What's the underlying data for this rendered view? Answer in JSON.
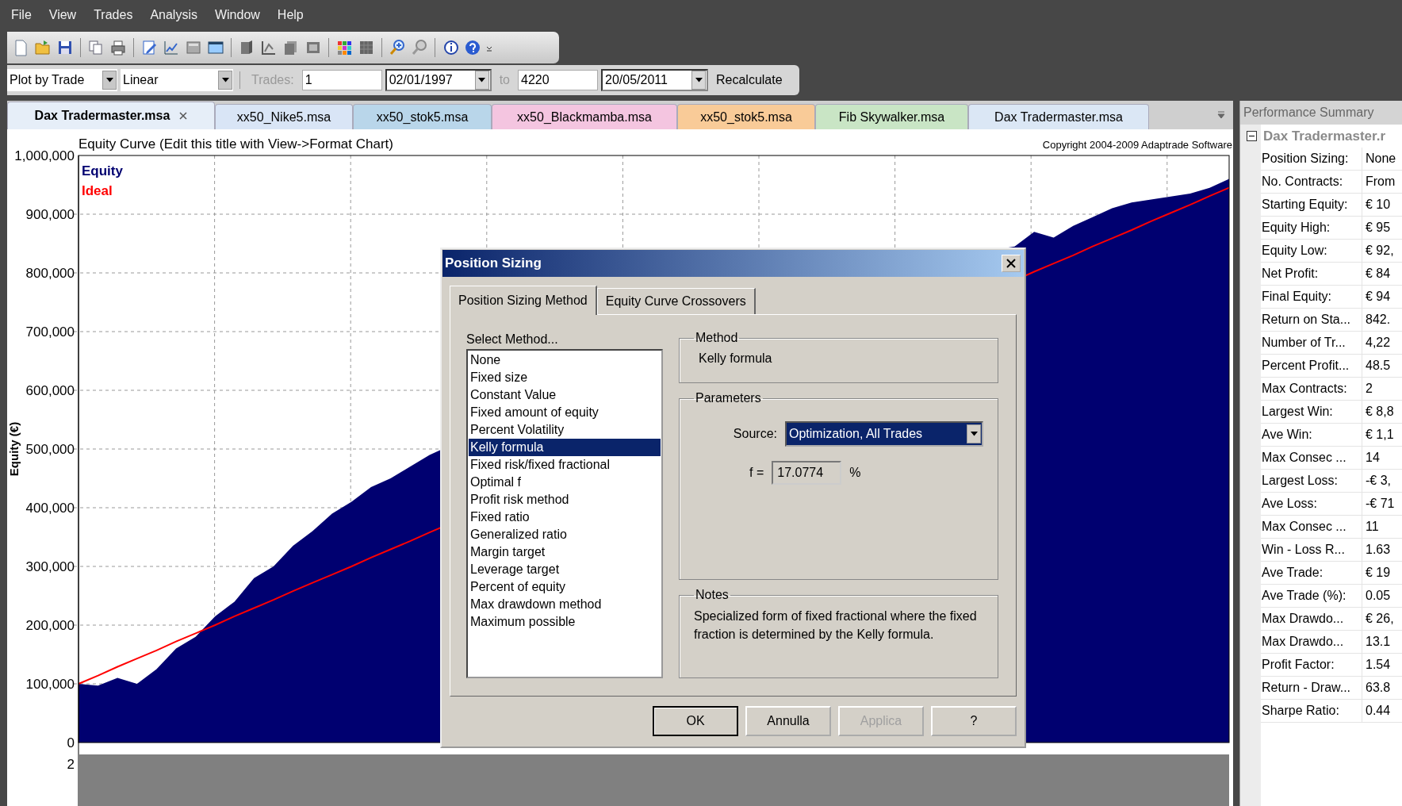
{
  "menu": [
    "File",
    "View",
    "Trades",
    "Analysis",
    "Window",
    "Help"
  ],
  "options_bar": {
    "plot_mode": "Plot by Trade",
    "scale": "Linear",
    "trades_label": "Trades:",
    "trades_from": "1",
    "date_from": "02/01/1997",
    "to_label": "to",
    "trades_to": "4220",
    "date_to": "20/05/2011",
    "recalculate": "Recalculate"
  },
  "document_tabs": [
    {
      "label": "Dax Tradermaster.msa",
      "selected": true,
      "closable": true,
      "color": "#e6eef8"
    },
    {
      "label": "xx50_Nike5.msa",
      "selected": false,
      "closable": false,
      "color": "#d9e5f6"
    },
    {
      "label": "xx50_stok5.msa",
      "selected": false,
      "closable": false,
      "color": "#b9d6ea"
    },
    {
      "label": "xx50_Blackmamba.msa",
      "selected": false,
      "closable": false,
      "color": "#f4c5e0"
    },
    {
      "label": "xx50_stok5.msa",
      "selected": false,
      "closable": false,
      "color": "#f9cb98"
    },
    {
      "label": "Fib Skywalker.msa",
      "selected": false,
      "closable": false,
      "color": "#c9e5c5"
    },
    {
      "label": "Dax Tradermaster.msa",
      "selected": false,
      "closable": false,
      "color": "#dbe7f5"
    }
  ],
  "chart": {
    "title": "Equity Curve (Edit this title with View->Format Chart)",
    "copyright": "Copyright 2004-2009 Adaptrade Software",
    "y_axis_label": "Equity (€)",
    "lower_pane_tick": "2",
    "legend": [
      {
        "name": "Equity",
        "color": "#000070"
      },
      {
        "name": "Ideal",
        "color": "#ff0000"
      }
    ],
    "y_ticks": [
      "1,000,000",
      "900,000",
      "800,000",
      "700,000",
      "600,000",
      "500,000",
      "400,000",
      "300,000",
      "200,000",
      "100,000",
      "0"
    ]
  },
  "performance": {
    "title": "Performance Summary",
    "root": {
      "label": "Dax Tradermaster.r",
      "expanded": true
    },
    "rows": [
      {
        "label": "Position Sizing:",
        "value": "None"
      },
      {
        "label": "No. Contracts:",
        "value": "From"
      },
      {
        "label": "Starting Equity:",
        "value": "€ 10"
      },
      {
        "label": "Equity High:",
        "value": "€ 95"
      },
      {
        "label": "Equity Low:",
        "value": "€ 92,"
      },
      {
        "label": "Net Profit:",
        "value": "€ 84"
      },
      {
        "label": "Final Equity:",
        "value": "€ 94"
      },
      {
        "label": "Return on Sta...",
        "value": "842."
      },
      {
        "label": "Number of Tr...",
        "value": "4,22"
      },
      {
        "label": "Percent Profit...",
        "value": "48.5"
      },
      {
        "label": "Max Contracts:",
        "value": "2"
      },
      {
        "label": "Largest Win:",
        "value": "€ 8,8"
      },
      {
        "label": "Ave Win:",
        "value": "€ 1,1"
      },
      {
        "label": "Max Consec ...",
        "value": "14"
      },
      {
        "label": "Largest Loss:",
        "value": "-€ 3,"
      },
      {
        "label": "Ave Loss:",
        "value": "-€ 71"
      },
      {
        "label": "Max Consec ...",
        "value": "11"
      },
      {
        "label": "Win - Loss R...",
        "value": "1.63"
      },
      {
        "label": "Ave Trade:",
        "value": "€ 19"
      },
      {
        "label": "Ave Trade (%):",
        "value": "0.05"
      },
      {
        "label": "Max Drawdo...",
        "value": "€ 26,"
      },
      {
        "label": "Max Drawdo...",
        "value": "13.1"
      },
      {
        "label": "Profit Factor:",
        "value": "1.54"
      },
      {
        "label": "Return - Draw...",
        "value": "63.8"
      },
      {
        "label": "Sharpe Ratio:",
        "value": "0.44"
      }
    ]
  },
  "dialog": {
    "title": "Position Sizing",
    "tabs": [
      {
        "label": "Position Sizing Method",
        "selected": true
      },
      {
        "label": "Equity Curve Crossovers",
        "selected": false
      }
    ],
    "method_list": {
      "label": "Select Method...",
      "items": [
        {
          "label": "None",
          "selected": false
        },
        {
          "label": "Fixed size",
          "selected": false
        },
        {
          "label": "Constant Value",
          "selected": false
        },
        {
          "label": "Fixed amount of equity",
          "selected": false
        },
        {
          "label": "Percent Volatility",
          "selected": false
        },
        {
          "label": "Kelly formula",
          "selected": true
        },
        {
          "label": "Fixed risk/fixed fractional",
          "selected": false
        },
        {
          "label": "Optimal f",
          "selected": false
        },
        {
          "label": "Profit risk method",
          "selected": false
        },
        {
          "label": "Fixed ratio",
          "selected": false
        },
        {
          "label": "Generalized ratio",
          "selected": false
        },
        {
          "label": "Margin target",
          "selected": false
        },
        {
          "label": "Leverage target",
          "selected": false
        },
        {
          "label": "Percent of equity",
          "selected": false
        },
        {
          "label": "Max drawdown method",
          "selected": false
        },
        {
          "label": "Maximum possible",
          "selected": false
        }
      ]
    },
    "method_group": {
      "title": "Method",
      "value": "Kelly formula"
    },
    "parameters": {
      "title": "Parameters",
      "source_label": "Source:",
      "source_value": "Optimization, All Trades",
      "f_label": "f =",
      "f_value": "17.0774",
      "f_unit": "%"
    },
    "notes": {
      "title": "Notes",
      "text": "Specialized form of fixed fractional where the fixed fraction is determined by the Kelly formula."
    },
    "buttons": [
      {
        "label": "OK",
        "default": true,
        "disabled": false
      },
      {
        "label": "Annulla",
        "default": false,
        "disabled": false
      },
      {
        "label": "Applica",
        "default": false,
        "disabled": true
      },
      {
        "label": "?",
        "default": false,
        "disabled": false
      }
    ]
  }
}
